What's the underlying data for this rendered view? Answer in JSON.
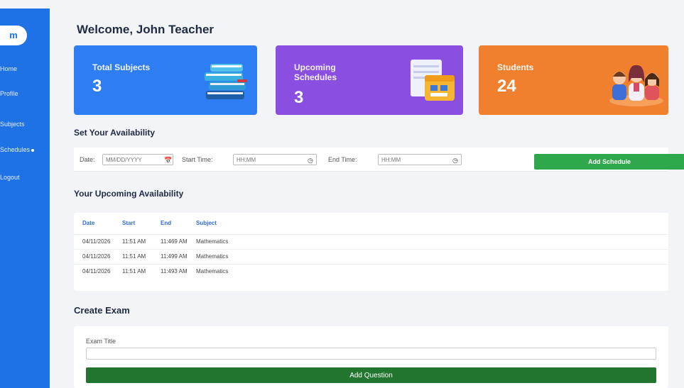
{
  "sidebar": {
    "logo": "m",
    "items": [
      {
        "label": "Home"
      },
      {
        "label": "Profile"
      },
      {
        "label": "Subjects"
      },
      {
        "label": "Schedules"
      },
      {
        "label": "Logout"
      }
    ]
  },
  "header": {
    "welcome": "Welcome, John Teacher"
  },
  "cards": [
    {
      "title": "Total Subjects",
      "value": "3",
      "color": "#2f7df2",
      "icon": "books-icon"
    },
    {
      "title": "Upcoming Schedules",
      "value": "3",
      "color": "#8a4fe0",
      "icon": "calendar-icon"
    },
    {
      "title": "Students",
      "value": "24",
      "color": "#f0802d",
      "icon": "students-icon"
    }
  ],
  "availability_form": {
    "title": "Set Your Availability",
    "date_label": "Date:",
    "date_placeholder": "MM/DD/YYYY",
    "start_label": "Start Time:",
    "start_placeholder": "HH:MM",
    "end_label": "End Time:",
    "end_placeholder": "HH:MM",
    "submit_label": "Add Schedule"
  },
  "upcoming": {
    "title": "Your Upcoming Availability",
    "columns": [
      "Date",
      "Start",
      "End",
      "Subject"
    ],
    "rows": [
      [
        "04/11/2026",
        "11:51 AM",
        "11:469 AM",
        "Mathematics"
      ],
      [
        "04/11/2026",
        "11:51 AM",
        "11:499 AM",
        "Mathematics"
      ],
      [
        "04/11/2026",
        "11:51 AM",
        "11:493 AM",
        "Mathematics"
      ]
    ]
  },
  "exam": {
    "title": "Create Exam",
    "field_label": "Exam Title",
    "field_value": "",
    "button_label": "Add Question"
  }
}
